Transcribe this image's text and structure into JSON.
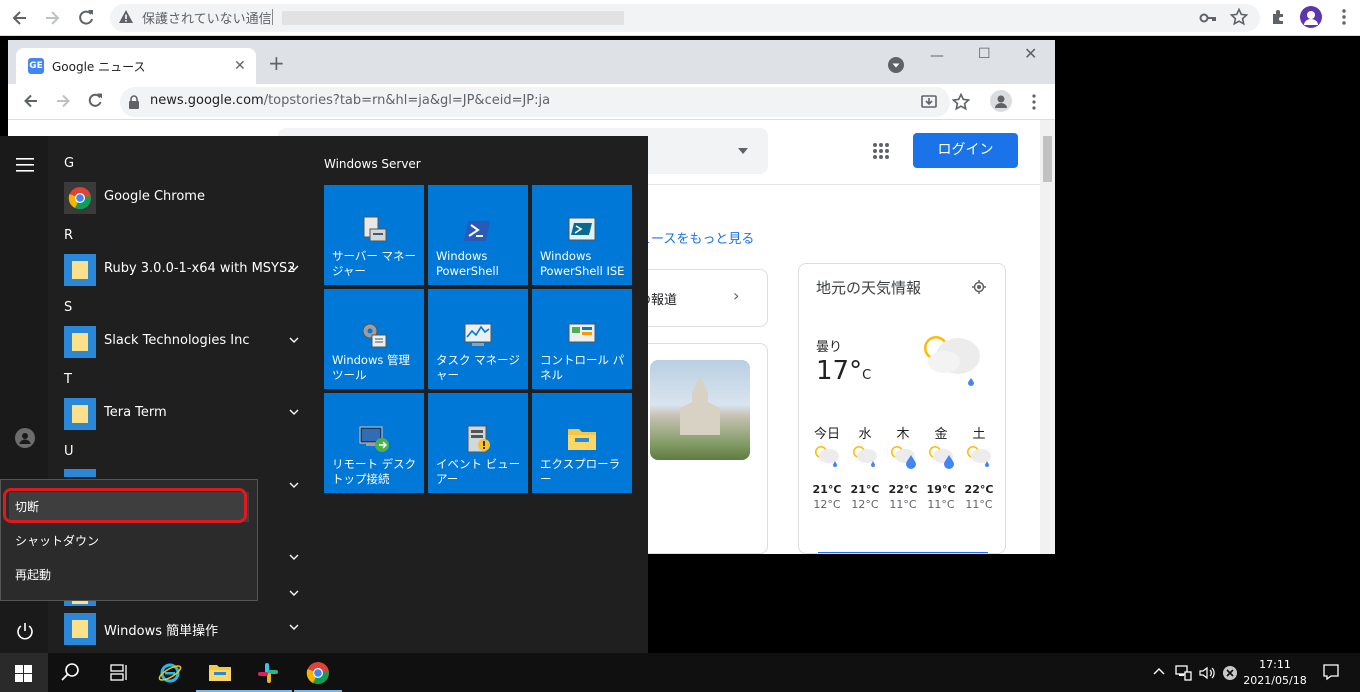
{
  "outer_browser": {
    "insecure_label": "保護されていない通信"
  },
  "inner_browser": {
    "tab_title": "Google ニュース",
    "tab_favicon": "GE",
    "url_host": "news.google.com",
    "url_path": "/topstories?tab=rn&hl=ja&gl=JP&ceid=JP:ja"
  },
  "news": {
    "login_label": "ログイン",
    "more_link": "ュースをもっと見る",
    "card_text": "の報道",
    "weather": {
      "title": "地元の天気情報",
      "condition": "曇り",
      "temp": "17°",
      "temp_unit": "C",
      "days": [
        {
          "day": "今日",
          "hi": "21°C",
          "lo": "12°C",
          "rain": false
        },
        {
          "day": "水",
          "hi": "21°C",
          "lo": "12°C",
          "rain": false
        },
        {
          "day": "木",
          "hi": "22°C",
          "lo": "11°C",
          "rain": true
        },
        {
          "day": "金",
          "hi": "19°C",
          "lo": "11°C",
          "rain": true
        },
        {
          "day": "土",
          "hi": "22°C",
          "lo": "11°C",
          "rain": false
        }
      ]
    }
  },
  "start_menu": {
    "groups": [
      {
        "letter": "G",
        "apps": [
          {
            "name": "Google Chrome",
            "icon": "chrome-icon",
            "expandable": false
          }
        ]
      },
      {
        "letter": "R",
        "apps": [
          {
            "name": "Ruby 3.0.0-1-x64 with MSYS2",
            "icon": "folder-icon",
            "expandable": true
          }
        ]
      },
      {
        "letter": "S",
        "apps": [
          {
            "name": "Slack Technologies Inc",
            "icon": "folder-icon",
            "expandable": true
          }
        ]
      },
      {
        "letter": "T",
        "apps": [
          {
            "name": "Tera Term",
            "icon": "folder-icon",
            "expandable": true
          }
        ]
      },
      {
        "letter": "U",
        "apps": []
      }
    ],
    "bottom_app": {
      "name": "Windows 簡単操作",
      "icon": "folder-icon",
      "expandable": true
    },
    "tiles_header": "Windows Server",
    "tiles": [
      {
        "label": "サーバー マネージャー",
        "icon": "server-manager-icon"
      },
      {
        "label": "Windows PowerShell",
        "icon": "powershell-icon"
      },
      {
        "label": "Windows PowerShell ISE",
        "icon": "powershell-ise-icon"
      },
      {
        "label": "Windows 管理ツール",
        "icon": "admin-tools-icon"
      },
      {
        "label": "タスク マネージャー",
        "icon": "task-manager-icon"
      },
      {
        "label": "コントロール パネル",
        "icon": "control-panel-icon"
      },
      {
        "label": "リモート デスクトップ接続",
        "icon": "remote-desktop-icon"
      },
      {
        "label": "イベント ビューアー",
        "icon": "event-viewer-icon"
      },
      {
        "label": "エクスプローラー",
        "icon": "explorer-icon"
      }
    ]
  },
  "power_menu": {
    "sleep": "切断",
    "shutdown": "シャットダウン",
    "restart": "再起動",
    "highlight_color": "#e0191f"
  },
  "taskbar": {
    "time": "17:11",
    "date": "2021/05/18"
  },
  "colors": {
    "tile_blue": "#0078d7",
    "login_blue": "#1a73e8"
  }
}
